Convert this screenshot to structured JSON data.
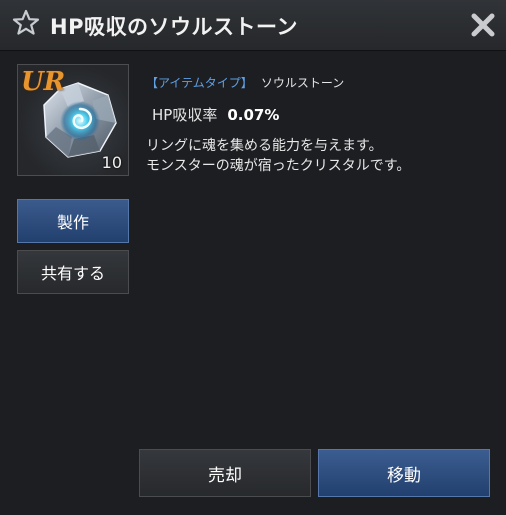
{
  "dialog": {
    "title": "HP吸収のソウルストーン",
    "title_icon": "star-icon",
    "close_icon": "close-icon"
  },
  "item": {
    "rarity": "UR",
    "count": "10",
    "icon": "soul-stone-gem-icon",
    "rarity_color": "#e8952e"
  },
  "info": {
    "type_label": "【アイテムタイプ】",
    "type_value": "ソウルストーン",
    "stat_label": "HP吸収率",
    "stat_value": "0.07%",
    "description_line1": "リングに魂を集める能力を与えます。",
    "description_line2": "モンスターの魂が宿ったクリスタルです。"
  },
  "actions": {
    "craft_label": "製作",
    "share_label": "共有する",
    "sell_label": "売却",
    "move_label": "移動"
  },
  "colors": {
    "accent_blue": "#22406e",
    "type_tag_blue": "#5fa0e6",
    "background": "#1c1e21"
  }
}
